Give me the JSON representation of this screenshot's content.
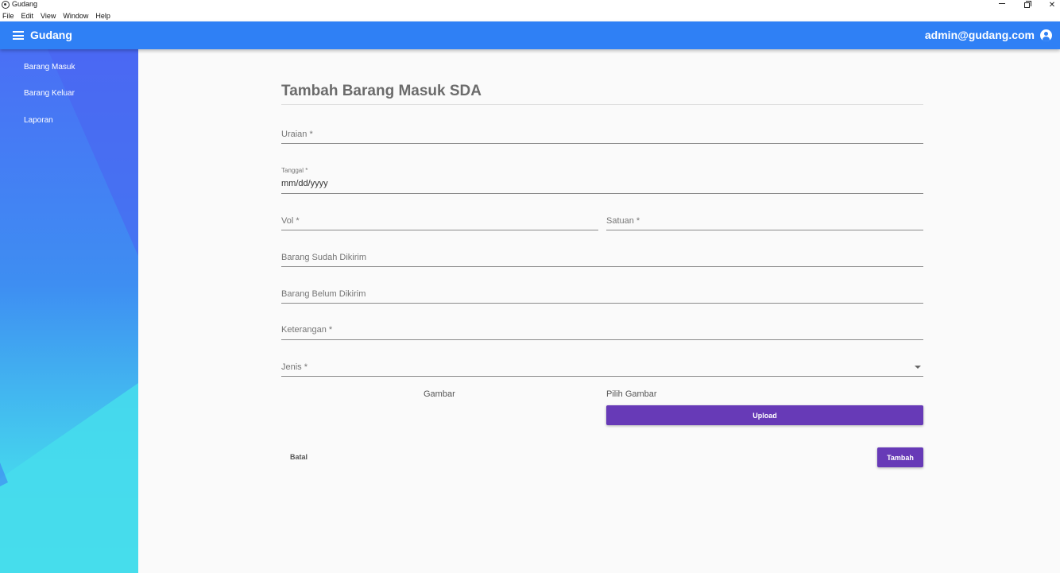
{
  "window": {
    "title": "Gudang",
    "menu": [
      "File",
      "Edit",
      "View",
      "Window",
      "Help"
    ]
  },
  "appbar": {
    "title": "Gudang",
    "user": "admin@gudang.com"
  },
  "sidebar": {
    "items": [
      {
        "label": "Barang Masuk"
      },
      {
        "label": "Barang Keluar"
      },
      {
        "label": "Laporan"
      }
    ]
  },
  "form": {
    "title": "Tambah Barang Masuk SDA",
    "uraian_label": "Uraian *",
    "tanggal_label": "Tanggal *",
    "tanggal_value": "mm/dd/yyyy",
    "vol_label": "Vol *",
    "satuan_label": "Satuan *",
    "sudah_dikirim_label": "Barang Sudah Dikirim",
    "belum_dikirim_label": "Barang Belum Dikirim",
    "keterangan_label": "Keterangan *",
    "jenis_label": "Jenis *",
    "gambar_label": "Gambar",
    "pilih_gambar_label": "Pilih Gambar",
    "upload_label": "Upload",
    "batal_label": "Batal",
    "tambah_label": "Tambah"
  },
  "colors": {
    "appbar": "#2f80f5",
    "primary_button": "#673ab7",
    "sidebar_top": "#4a6ff5",
    "sidebar_bottom": "#47e8e8"
  }
}
